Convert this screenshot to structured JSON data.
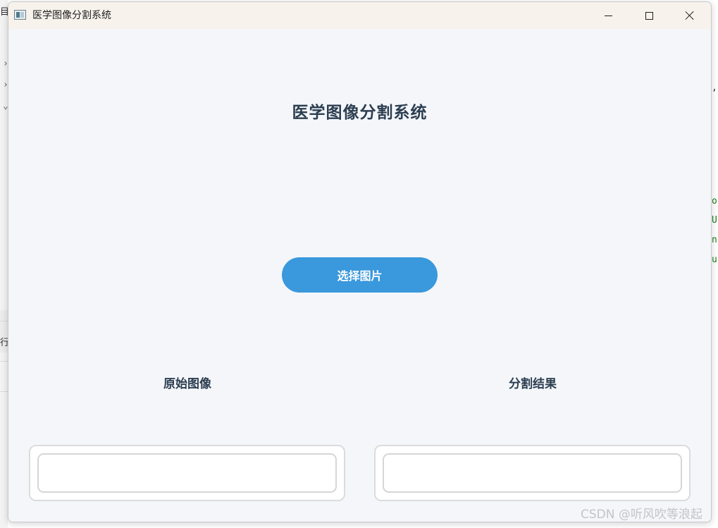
{
  "window": {
    "title": "医学图像分割系统"
  },
  "main": {
    "heading": "医学图像分割系统",
    "select_button_label": "选择图片",
    "panels": [
      {
        "label": "原始图像"
      },
      {
        "label": "分割结果"
      }
    ]
  },
  "background": {
    "left_glyphs": [
      "目",
      "行"
    ],
    "left_marks": [
      "›",
      "›",
      "⌄"
    ],
    "right_comma": ",",
    "right_code": [
      "o",
      "U",
      "n",
      "u"
    ]
  },
  "watermark": "CSDN @听风吹等浪起",
  "colors": {
    "titlebar": "#f7f2ec",
    "window_bg": "#f4f6fa",
    "accent_button": "#3a98dc",
    "heading_text": "#2c3e50"
  }
}
